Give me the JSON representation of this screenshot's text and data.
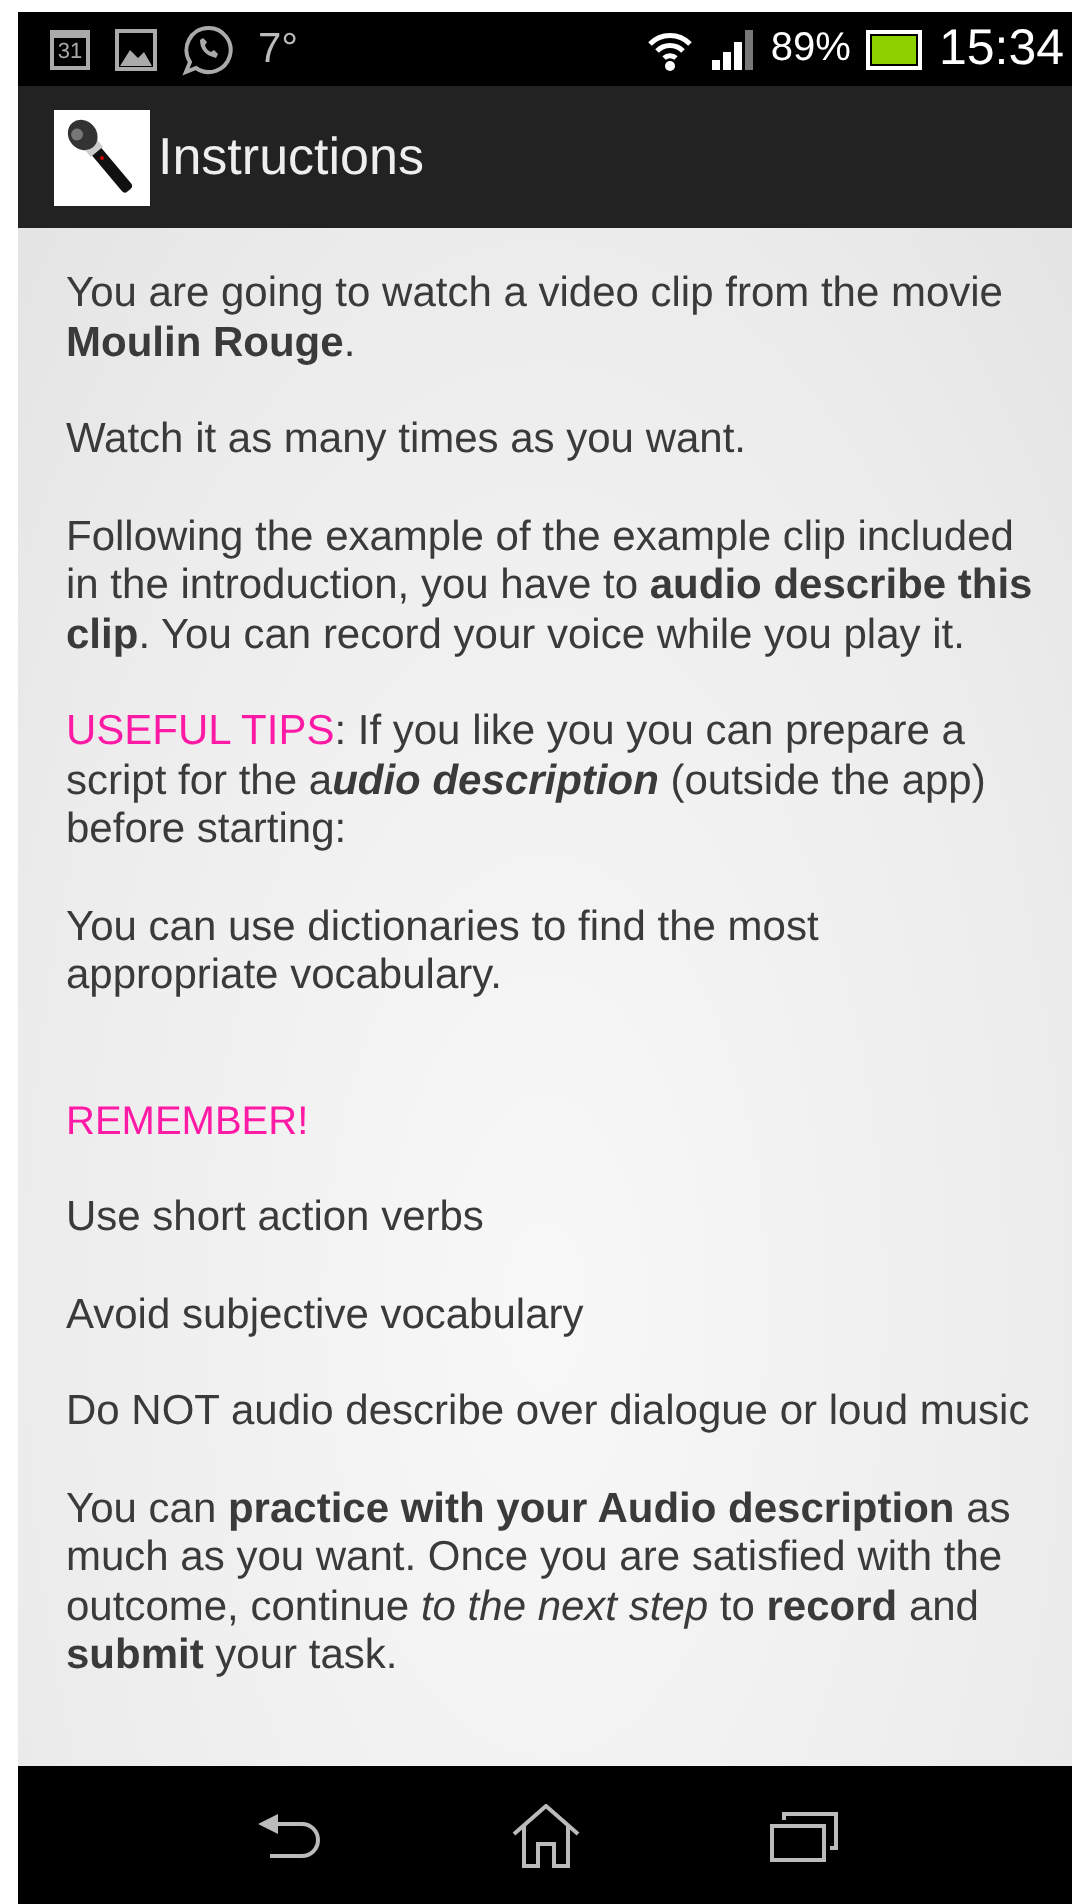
{
  "status_bar": {
    "calendar_day": "31",
    "temperature": "7°",
    "battery_percent": "89%",
    "time": "15:34"
  },
  "action_bar": {
    "title": "Instructions"
  },
  "paragraphs": [
    {
      "kind": "text",
      "text": "You are going to watch a video clip from the movie **Moulin Rouge**."
    },
    {
      "kind": "text",
      "text": "Watch it as many times as you want."
    },
    {
      "kind": "text",
      "text": "Following the example of the example clip included in the introduction, you have to **audio describe this clip**. You can record your voice while you play it."
    },
    {
      "kind": "tip",
      "lead": "USEFUL TIPS",
      "text": ": If you like you you can prepare a script for the a",
      "emphasis": "udio description",
      "after": " (outside the app) before starting:"
    },
    {
      "kind": "text",
      "text": "You can use dictionaries to find the most appropriate vocabulary."
    },
    {
      "kind": "heading",
      "text": "REMEMBER!"
    },
    {
      "kind": "text",
      "text": "Use short action verbs"
    },
    {
      "kind": "text",
      "text": "Avoid subjective vocabulary"
    },
    {
      "kind": "text",
      "text": "Do NOT audio describe over dialogue or loud music"
    },
    {
      "kind": "text",
      "text": "You can **practice with your Audio description** as much as you want. Once you are satisfied with the outcome, continue *to the next step* to **record** and **submit** your task."
    }
  ]
}
